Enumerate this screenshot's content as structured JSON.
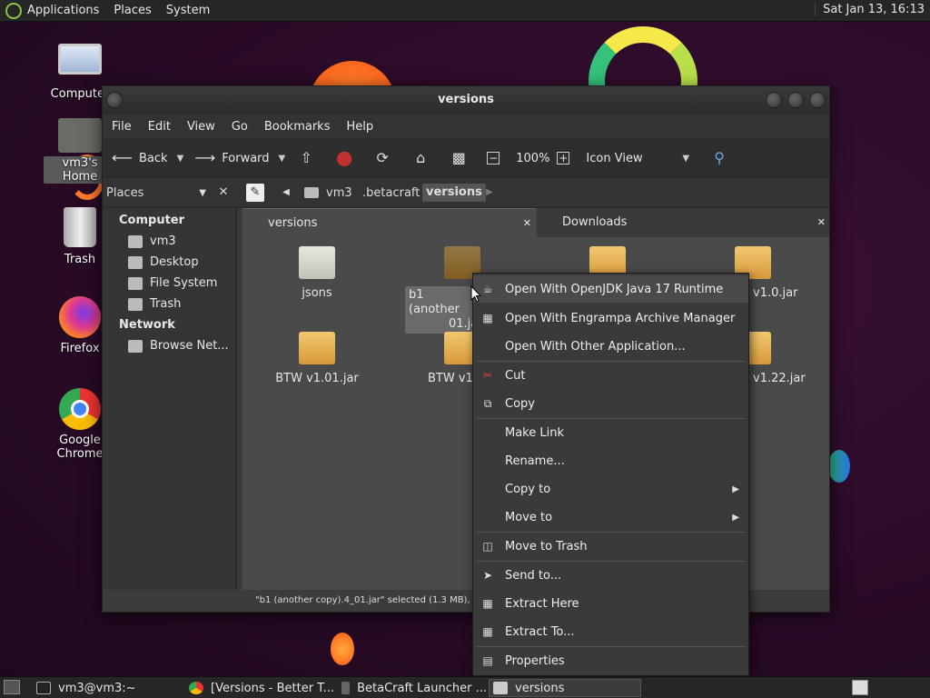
{
  "top_panel": {
    "menus": [
      "Applications",
      "Places",
      "System"
    ],
    "clock": "Sat Jan 13, 16:13"
  },
  "desktop_icons": [
    {
      "label": "Computer",
      "icon": "computer-icon"
    },
    {
      "label": "vm3's Home",
      "icon": "home-folder-icon"
    },
    {
      "label": "Trash",
      "icon": "trash-icon"
    },
    {
      "label": "Firefox",
      "icon": "firefox-icon"
    },
    {
      "label": "Google Chrome",
      "icon": "chrome-icon"
    }
  ],
  "window": {
    "title": "versions",
    "menus": [
      "File",
      "Edit",
      "View",
      "Go",
      "Bookmarks",
      "Help"
    ],
    "toolbar": {
      "back": "Back",
      "forward": "Forward",
      "zoom": "100%",
      "view_mode": "Icon View"
    },
    "location": {
      "crumbs": [
        "vm3",
        ".betacraft",
        "versions"
      ]
    },
    "sidebar": {
      "selector": "Places",
      "computer_header": "Computer",
      "computer_items": [
        "vm3",
        "Desktop",
        "File System",
        "Trash"
      ],
      "network_header": "Network",
      "network_items": [
        "Browse Net..."
      ]
    },
    "tabs": [
      "versions",
      "Downloads"
    ],
    "files": [
      {
        "name": "jsons",
        "type": "folder"
      },
      {
        "name": "b1 (another copy).4_01.jar",
        "type": "jar",
        "selected": true
      },
      {
        "name": "",
        "type": "jar"
      },
      {
        "name": "v1.0.jar",
        "type": "jar"
      },
      {
        "name": "BTW v1.01.jar",
        "type": "jar"
      },
      {
        "name": "BTW v1.2",
        "type": "jar"
      },
      {
        "name": "v1.22.jar",
        "type": "jar"
      }
    ],
    "selected_label": [
      "b1 (another",
      "01.jar"
    ],
    "status": "\"b1 (another copy).4_01.jar\" selected (1.3 MB), Fre"
  },
  "context_menu": {
    "items": [
      {
        "label": "Open With OpenJDK Java 17 Runtime",
        "icon": "java-icon"
      },
      {
        "label": "Open With Engrampa Archive Manager",
        "icon": "archive-manager-icon"
      },
      {
        "label": "Open With Other Application...",
        "icon": ""
      },
      {
        "label": "Cut",
        "icon": "scissors-icon"
      },
      {
        "label": "Copy",
        "icon": "copy-icon"
      },
      {
        "label": "Make Link",
        "icon": ""
      },
      {
        "label": "Rename...",
        "icon": ""
      },
      {
        "label": "Copy to",
        "icon": "",
        "submenu": true
      },
      {
        "label": "Move to",
        "icon": "",
        "submenu": true
      },
      {
        "label": "Move to Trash",
        "icon": "trash-icon"
      },
      {
        "label": "Send to...",
        "icon": "send-icon"
      },
      {
        "label": "Extract Here",
        "icon": "extract-icon"
      },
      {
        "label": "Extract To...",
        "icon": "extract-icon"
      },
      {
        "label": "Properties",
        "icon": "properties-icon"
      }
    ]
  },
  "taskbar": [
    {
      "label": "vm3@vm3:~",
      "icon": "terminal-icon"
    },
    {
      "label": "[Versions - Better T...",
      "icon": "chrome-icon"
    },
    {
      "label": "BetaCraft Launcher ...",
      "icon": "java-icon"
    },
    {
      "label": "versions",
      "icon": "folder-icon",
      "active": true
    }
  ]
}
